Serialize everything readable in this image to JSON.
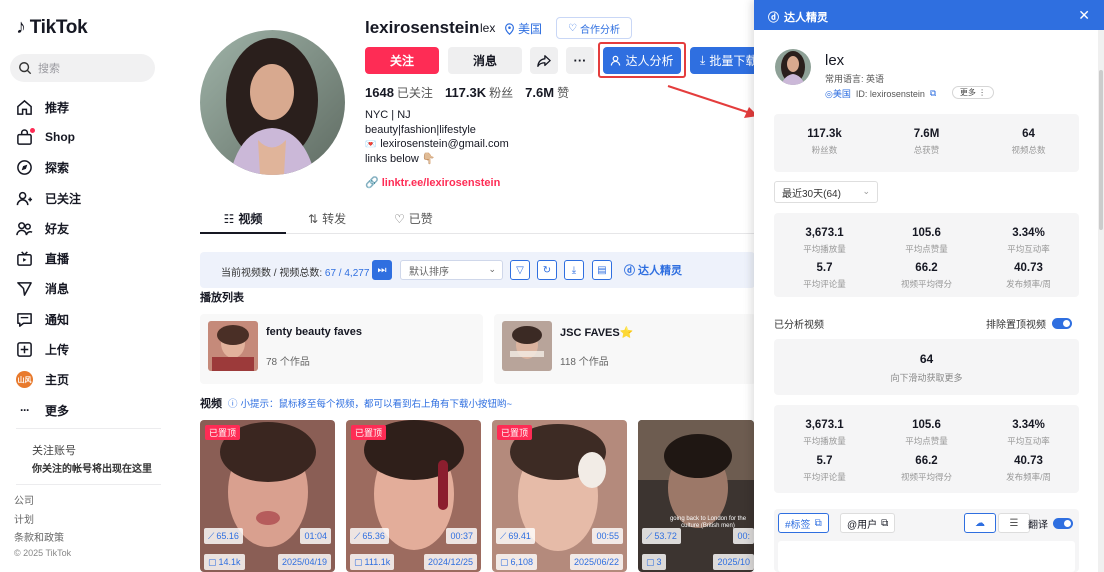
{
  "sidebar": {
    "brand": "TikTok",
    "search_placeholder": "搜索",
    "nav": [
      {
        "label": "推荐",
        "icon": "home-icon"
      },
      {
        "label": "Shop",
        "icon": "shop-icon"
      },
      {
        "label": "探索",
        "icon": "compass-icon"
      },
      {
        "label": "已关注",
        "icon": "user-follow-icon"
      },
      {
        "label": "好友",
        "icon": "friends-icon"
      },
      {
        "label": "直播",
        "icon": "live-icon"
      },
      {
        "label": "消息",
        "icon": "send-icon"
      },
      {
        "label": "通知",
        "icon": "chat-icon"
      },
      {
        "label": "上传",
        "icon": "upload-icon"
      },
      {
        "label": "主页",
        "icon": "avatar"
      },
      {
        "label": "更多",
        "icon": "more-icon"
      }
    ],
    "avatar_text": "山风",
    "follow_title": "关注账号",
    "follow_sub": "你关注的帐号将出现在这里",
    "footer": [
      "公司",
      "计划",
      "条款和政策"
    ],
    "copyright": "© 2025 TikTok"
  },
  "profile": {
    "username": "lexirosenstein",
    "nickname": "lex",
    "region": "美国",
    "collab_label": "合作分析",
    "follow_label": "关注",
    "message_label": "消息",
    "more_label": "···",
    "analyze_label": "达人分析",
    "batch_label": "批量下载",
    "stats": [
      {
        "value": "1648",
        "label": "已关注"
      },
      {
        "value": "117.3K",
        "label": "粉丝"
      },
      {
        "value": "7.6M",
        "label": "赞"
      }
    ],
    "bio": [
      "NYC | NJ",
      "beauty|fashion|lifestyle",
      "lexirosenstein@gmail.com",
      "links below 👇🏼"
    ],
    "link": "linktr.ee/lexirosenstein"
  },
  "tabs": [
    {
      "label": "视频",
      "icon": "grid-icon"
    },
    {
      "label": "转发",
      "icon": "repost-icon"
    },
    {
      "label": "已赞",
      "icon": "heart-icon"
    }
  ],
  "toolbar": {
    "count_label": "当前视频数 / 视频总数:",
    "count_value": "67 / 4,277",
    "sort_label": "默认排序",
    "brand": "达人精灵"
  },
  "playlist": {
    "title": "播放列表",
    "items": [
      {
        "name": "fenty beauty faves",
        "count": "78 个作品"
      },
      {
        "name": "JSC FAVES⭐",
        "count": "118 个作品"
      }
    ]
  },
  "videos": {
    "title": "视频",
    "tip": "小提示：鼠标移至每个视频，都可以看到右上角有下载小按钮哟~",
    "items": [
      {
        "badge": "已置顶",
        "score": "65.16",
        "duration": "01:04",
        "count": "14.1k",
        "date": "2025/04/19"
      },
      {
        "badge": "已置顶",
        "score": "65.36",
        "duration": "00:37",
        "count": "111.1k",
        "date": "2024/12/25"
      },
      {
        "badge": "已置顶",
        "score": "69.41",
        "duration": "00:55",
        "count": "6,108",
        "date": "2025/06/22"
      },
      {
        "badge": "",
        "score": "53.72",
        "duration": "00:",
        "count": "3",
        "date": "2025/10",
        "caption": "going back to London for the culture (British men)"
      }
    ]
  },
  "panel": {
    "title": "达人精灵",
    "name": "lex",
    "language": "常用语言: 英语",
    "region": "美国",
    "id_label": "ID: lexirosenstein",
    "more": "更多 ⋮",
    "summary": [
      {
        "value": "117.3k",
        "label": "粉丝数"
      },
      {
        "value": "7.6M",
        "label": "总获赞"
      },
      {
        "value": "64",
        "label": "视频总数"
      }
    ],
    "period": "最近30天(64)",
    "metrics_a": [
      {
        "value": "3,673.1",
        "label": "平均播放量"
      },
      {
        "value": "105.6",
        "label": "平均点赞量"
      },
      {
        "value": "3.34%",
        "label": "平均互动率"
      },
      {
        "value": "5.7",
        "label": "平均评论量"
      },
      {
        "value": "66.2",
        "label": "视频平均得分"
      },
      {
        "value": "40.73",
        "label": "发布频率/周"
      }
    ],
    "analyzed_label": "已分析视频",
    "exclude_label": "排除置顶视频",
    "load_value": "64",
    "load_label": "向下滑动获取更多",
    "metrics_b": [
      {
        "value": "3,673.1",
        "label": "平均播放量"
      },
      {
        "value": "105.6",
        "label": "平均点赞量"
      },
      {
        "value": "3.34%",
        "label": "平均互动率"
      },
      {
        "value": "5.7",
        "label": "平均评论量"
      },
      {
        "value": "66.2",
        "label": "视频平均得分"
      },
      {
        "value": "40.73",
        "label": "发布频率/周"
      }
    ],
    "tag_tab": "#标签",
    "user_tab": "@用户",
    "translate_label": "翻译"
  },
  "colors": {
    "accent": "#2f6fe0",
    "brand": "#fe2c55",
    "highlight": "#e43d3d"
  }
}
